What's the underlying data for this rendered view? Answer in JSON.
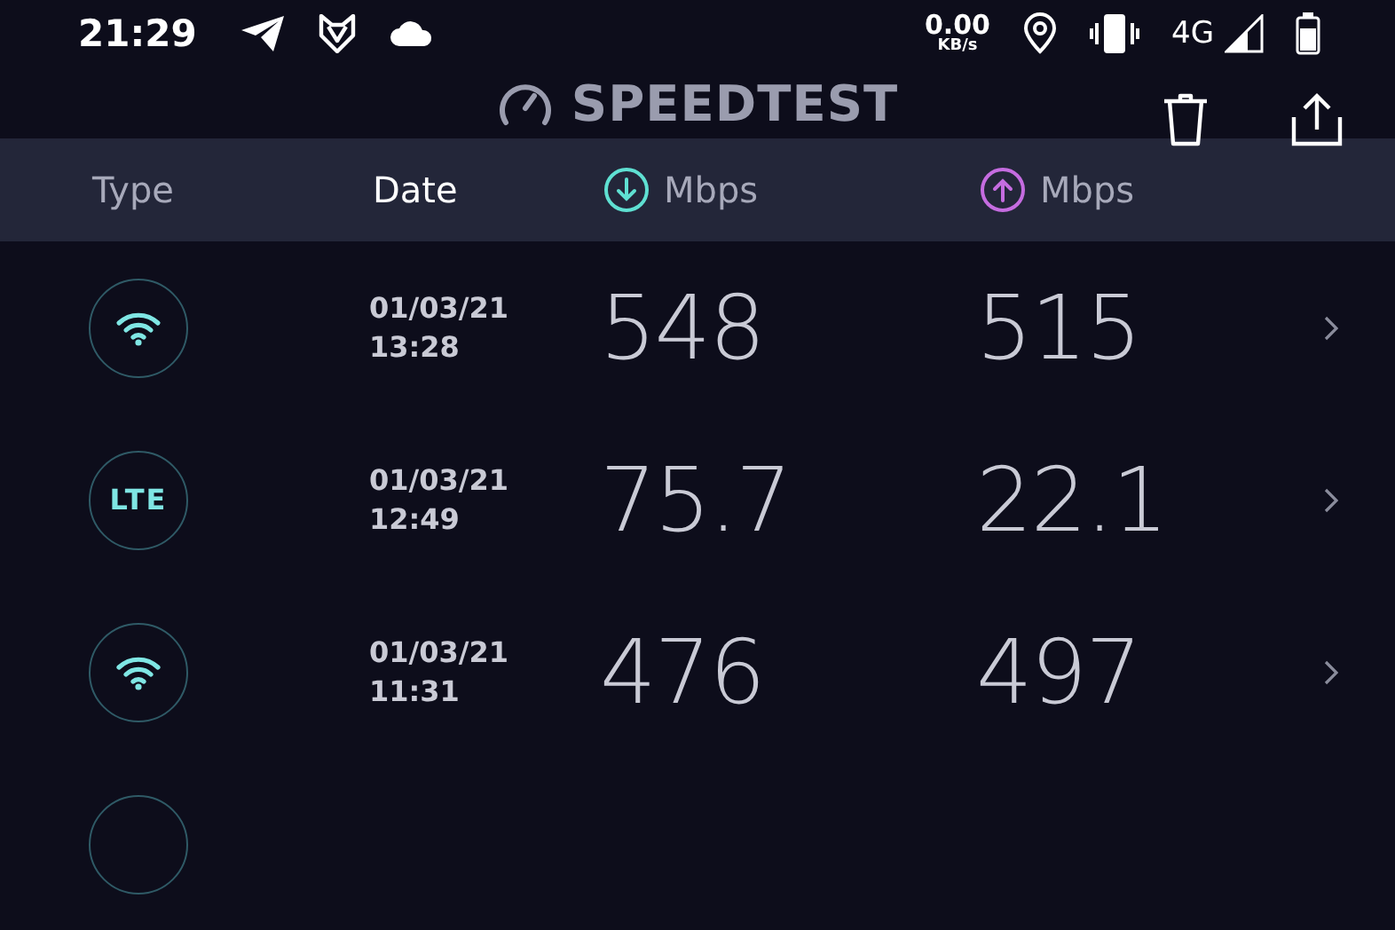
{
  "status_bar": {
    "time": "21:29",
    "speed_value": "0.00",
    "speed_unit": "KB/s",
    "network": "4G"
  },
  "app_bar": {
    "title": "SPEEDTEST"
  },
  "columns": [
    {
      "label": "Type",
      "kind": "text",
      "selected": false
    },
    {
      "label": "Date",
      "kind": "text",
      "selected": true
    },
    {
      "label": "Mbps",
      "kind": "download",
      "selected": false
    },
    {
      "label": "Mbps",
      "kind": "upload",
      "selected": false
    }
  ],
  "results": [
    {
      "kind": "wifi",
      "date": "01/03/21",
      "time": "13:28",
      "download": "548",
      "upload": "515"
    },
    {
      "kind": "lte",
      "label": "LTE",
      "date": "01/03/21",
      "time": "12:49",
      "download": "75.7",
      "upload": "22.1"
    },
    {
      "kind": "wifi",
      "date": "01/03/21",
      "time": "11:31",
      "download": "476",
      "upload": "497"
    },
    {
      "kind": "hidden"
    }
  ]
}
